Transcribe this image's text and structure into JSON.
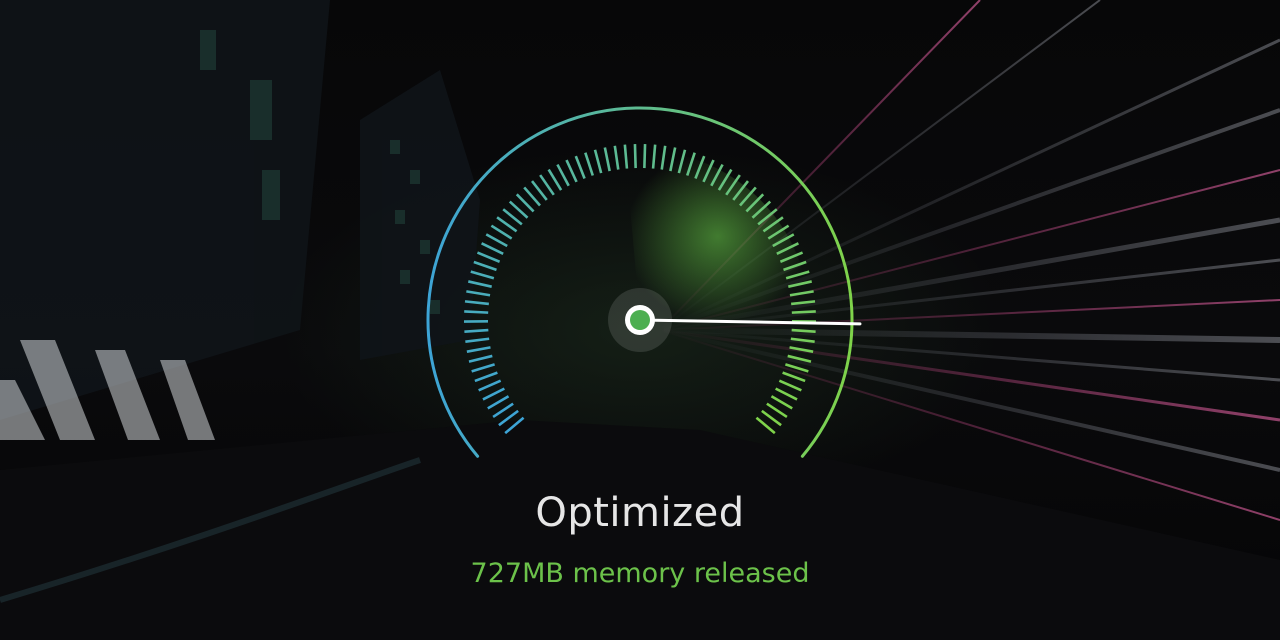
{
  "status": {
    "title": "Optimized",
    "message": "727MB memory released"
  },
  "gauge": {
    "level": 0.85,
    "colors": {
      "start": "#3da4d6",
      "end": "#7fd34a",
      "needle": "#ffffff",
      "hub": "#4caf50"
    }
  },
  "theme": {
    "accent_text": "#6cc24a",
    "title_text": "#e6e6e6"
  }
}
